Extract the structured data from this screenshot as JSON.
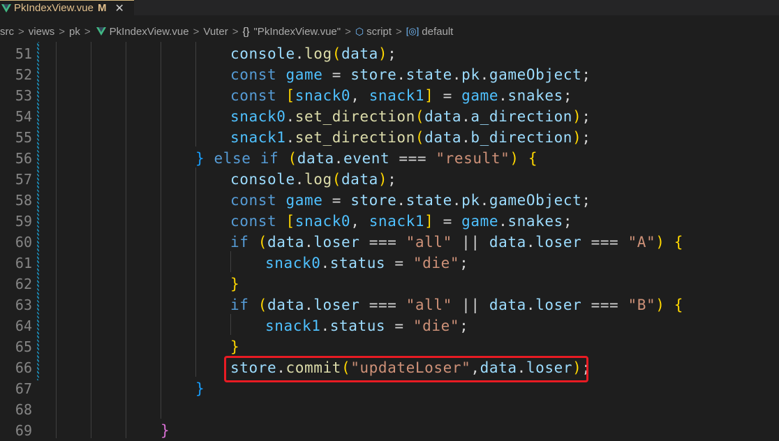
{
  "tab": {
    "file_name": "PkIndexView.vue",
    "modified_flag": "M",
    "close_glyph": "✕"
  },
  "breadcrumb": {
    "items": [
      "src",
      "views",
      "pk",
      "PkIndexView.vue",
      "Vuter",
      "\"PkIndexView.vue\"",
      "script",
      "default"
    ],
    "separator": ">",
    "braces_glyph": "{}"
  },
  "editor": {
    "line_numbers": [
      "51",
      "52",
      "53",
      "54",
      "55",
      "56",
      "57",
      "58",
      "59",
      "60",
      "61",
      "62",
      "63",
      "64",
      "65",
      "66",
      "67",
      "68",
      "69"
    ],
    "lines": [
      "console.log(data);",
      "const game = store.state.pk.gameObject;",
      "const [snack0, snack1] = game.snakes;",
      "snack0.set_direction(data.a_direction);",
      "snack1.set_direction(data.b_direction);",
      "} else if (data.event === \"result\") {",
      "console.log(data);",
      "const game = store.state.pk.gameObject;",
      "const [snack0, snack1] = game.snakes;",
      "if (data.loser === \"all\" || data.loser === \"A\") {",
      "snack0.status = \"die\";",
      "}",
      "if (data.loser === \"all\" || data.loser === \"B\") {",
      "snack1.status = \"die\";",
      "}",
      "store.commit(\"updateLoser\",data.loser);",
      "}",
      "",
      "}"
    ],
    "highlighted_line": "66"
  },
  "colors": {
    "background": "#1e1e1e",
    "keyword": "#569cd6",
    "variable": "#9cdcfe",
    "function": "#dcdcaa",
    "string": "#ce9178",
    "highlight_box": "#e81b23"
  }
}
